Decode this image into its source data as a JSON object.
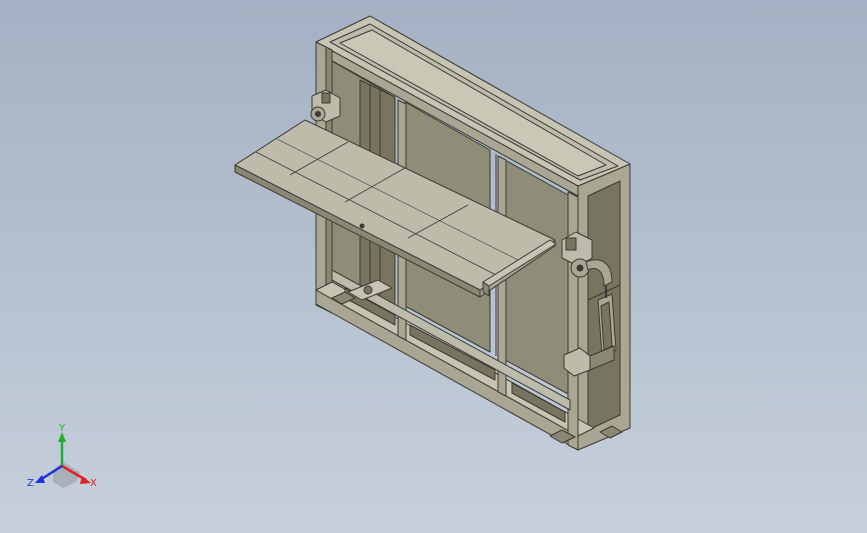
{
  "triad": {
    "labels": {
      "x": "X",
      "y": "Y",
      "z": "Z"
    },
    "colors": {
      "x": "#e02020",
      "y": "#20b030",
      "z": "#2030e0"
    }
  },
  "model": {
    "icon_name": "cabinet-frame-with-fold-down-shelf",
    "colors": {
      "background_top": "#a4b1c4",
      "background_bottom": "#c7d0dc",
      "frame_light": "#c6c4b3",
      "frame_mid": "#a9a693",
      "frame_dark": "#8a8875",
      "panel": "#8f8d78",
      "panel_dark": "#77755f",
      "shelf_top": "#bdbba9",
      "edge": "#3b3a32"
    }
  }
}
